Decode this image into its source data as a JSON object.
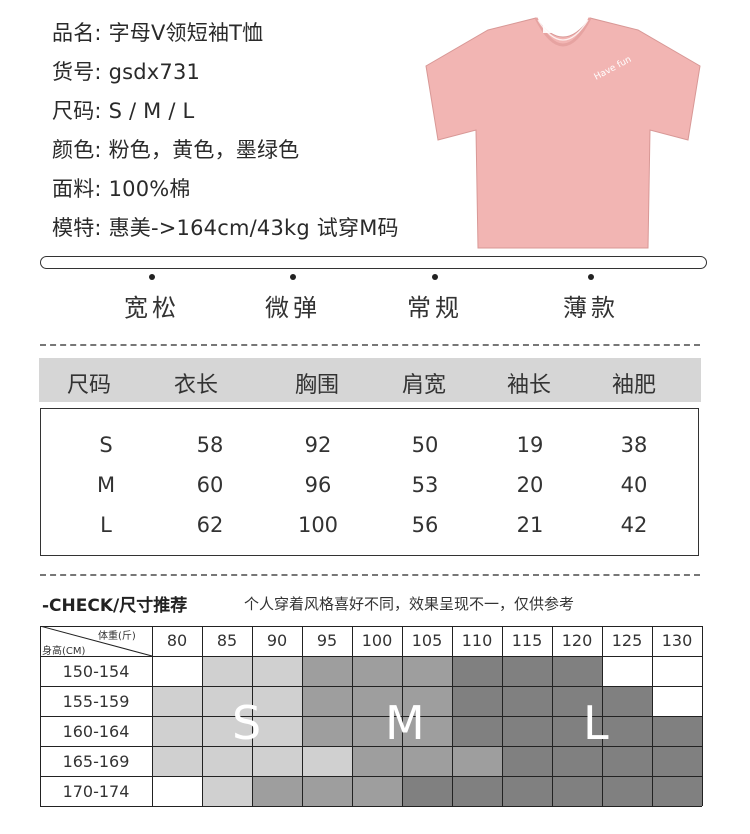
{
  "product": {
    "name_label": "品名:",
    "name_value": "字母V领短袖T恤",
    "sku_label": "货号:",
    "sku_value": "gsdx731",
    "size_label": "尺码:",
    "size_value": "S / M / L",
    "color_label": "颜色:",
    "color_value": "粉色，黄色，墨绿色",
    "fabric_label": "面料:",
    "fabric_value": "100%棉",
    "model_label": "模特:",
    "model_value": "惠美->164cm/43kg  试穿M码"
  },
  "shirt": {
    "color": "#f2b5b3",
    "print_text": "Have fun"
  },
  "attributes": [
    "宽松",
    "微弹",
    "常规",
    "薄款"
  ],
  "size_table": {
    "headers": [
      "尺码",
      "衣长",
      "胸围",
      "肩宽",
      "袖长",
      "袖肥"
    ],
    "rows": [
      [
        "S",
        "58",
        "92",
        "50",
        "19",
        "38"
      ],
      [
        "M",
        "60",
        "96",
        "53",
        "20",
        "40"
      ],
      [
        "L",
        "62",
        "100",
        "56",
        "21",
        "42"
      ]
    ]
  },
  "check": {
    "title": "-CHECK/尺寸推荐",
    "note": "个人穿着风格喜好不同，效果呈现不一，仅供参考"
  },
  "rec_table": {
    "corner_top": "体重(斤)",
    "corner_bottom": "身高(CM)",
    "weights": [
      "80",
      "85",
      "90",
      "95",
      "100",
      "105",
      "110",
      "115",
      "120",
      "125",
      "130"
    ],
    "heights": [
      "150-154",
      "155-159",
      "160-164",
      "165-169",
      "170-174"
    ],
    "shade_levels": [
      [
        0,
        2,
        2,
        3,
        3,
        3,
        4,
        4,
        4,
        0,
        0
      ],
      [
        2,
        2,
        2,
        3,
        3,
        3,
        4,
        4,
        4,
        4,
        0
      ],
      [
        2,
        2,
        2,
        3,
        3,
        3,
        4,
        4,
        4,
        4,
        4
      ],
      [
        2,
        2,
        2,
        2,
        3,
        3,
        3,
        4,
        4,
        4,
        4
      ],
      [
        0,
        2,
        3,
        3,
        3,
        4,
        4,
        4,
        4,
        4,
        4
      ]
    ],
    "shade_colors": [
      "#ffffff",
      "#e6e6e6",
      "#d0d0d0",
      "#9e9e9e",
      "#808080"
    ],
    "size_letters": [
      "S",
      "M",
      "L"
    ]
  }
}
